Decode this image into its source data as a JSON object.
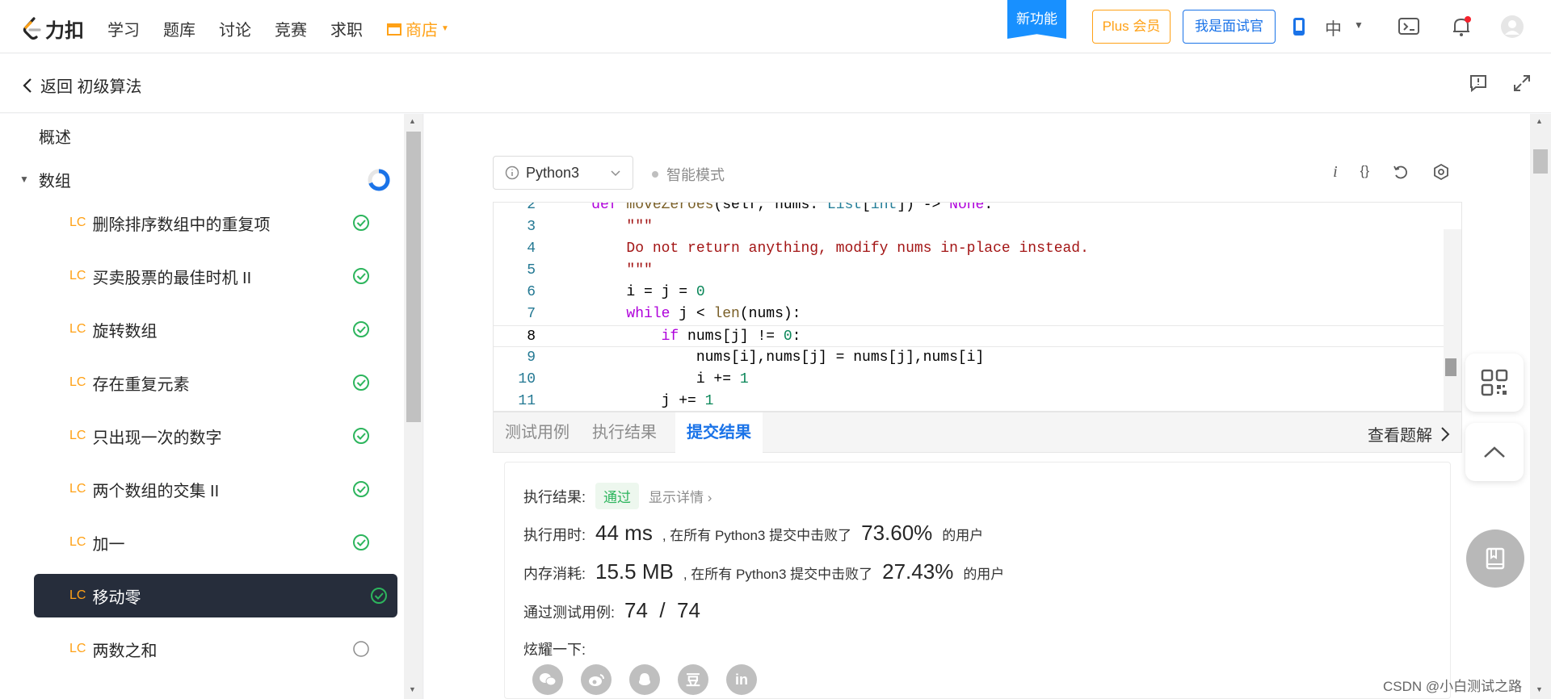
{
  "topnav": {
    "logo_text": "力扣",
    "links": [
      "学习",
      "题库",
      "讨论",
      "竞赛",
      "求职"
    ],
    "shop_label": "商店",
    "new_feature": "新功能",
    "plus_label": "Plus 会员",
    "interviewer_label": "我是面试官",
    "lang_label": "中"
  },
  "subheader": {
    "back_label": "返回 初级算法"
  },
  "sidebar": {
    "overview_label": "概述",
    "section_label": "数组",
    "items": [
      {
        "prefix": "LC",
        "label": "删除排序数组中的重复项",
        "status": "done"
      },
      {
        "prefix": "LC",
        "label": "买卖股票的最佳时机 II",
        "status": "done"
      },
      {
        "prefix": "LC",
        "label": "旋转数组",
        "status": "done"
      },
      {
        "prefix": "LC",
        "label": "存在重复元素",
        "status": "done"
      },
      {
        "prefix": "LC",
        "label": "只出现一次的数字",
        "status": "done"
      },
      {
        "prefix": "LC",
        "label": "两个数组的交集 II",
        "status": "done"
      },
      {
        "prefix": "LC",
        "label": "加一",
        "status": "done"
      },
      {
        "prefix": "LC",
        "label": "移动零",
        "status": "done",
        "active": true
      },
      {
        "prefix": "LC",
        "label": "两数之和",
        "status": "todo"
      }
    ]
  },
  "editor": {
    "language": "Python3",
    "smart_mode": "智能模式",
    "info_icon_label": "i",
    "braces_icon_label": "{}",
    "highlighted_line": "8",
    "lines": [
      {
        "no": "2",
        "segments": [
          [
            "kw",
            "    def "
          ],
          [
            "fn",
            "moveZeroes"
          ],
          [
            "",
            "(self, nums: "
          ],
          [
            "ty",
            "List"
          ],
          [
            "",
            "["
          ],
          [
            "ty",
            "int"
          ],
          [
            "",
            "]) -> "
          ],
          [
            "kw",
            "None"
          ],
          [
            "",
            ":"
          ]
        ]
      },
      {
        "no": "3",
        "segments": [
          [
            "str",
            "        \"\"\""
          ]
        ]
      },
      {
        "no": "4",
        "segments": [
          [
            "str",
            "        Do not return anything, modify nums in-place instead."
          ]
        ]
      },
      {
        "no": "5",
        "segments": [
          [
            "str",
            "        \"\"\""
          ]
        ]
      },
      {
        "no": "6",
        "segments": [
          [
            "",
            "        i = j = "
          ],
          [
            "num",
            "0"
          ]
        ]
      },
      {
        "no": "7",
        "segments": [
          [
            "kw",
            "        while "
          ],
          [
            "",
            "j < "
          ],
          [
            "fn",
            "len"
          ],
          [
            "",
            "(nums):"
          ]
        ]
      },
      {
        "no": "8",
        "segments": [
          [
            "kw",
            "            if "
          ],
          [
            "",
            "nums[j] != "
          ],
          [
            "num",
            "0"
          ],
          [
            "",
            ":"
          ]
        ]
      },
      {
        "no": "9",
        "segments": [
          [
            "",
            "                nums[i],nums[j] = nums[j],nums[i]"
          ]
        ]
      },
      {
        "no": "10",
        "segments": [
          [
            "",
            "                i += "
          ],
          [
            "num",
            "1"
          ]
        ]
      },
      {
        "no": "11",
        "segments": [
          [
            "",
            "            j += "
          ],
          [
            "num",
            "1"
          ]
        ]
      }
    ]
  },
  "tabs": {
    "items": [
      "测试用例",
      "执行结果",
      "提交结果"
    ],
    "active": "提交结果",
    "solution_label": "查看题解"
  },
  "result": {
    "status_label": "执行结果:",
    "status_value": "通过",
    "detail_label": "显示详情 ›",
    "time_label": "执行用时:",
    "time_value": "44 ms",
    "time_text_1": ", 在所有 Python3 提交中击败了",
    "time_percent": "73.60%",
    "time_text_2": "的用户",
    "mem_label": "内存消耗:",
    "mem_value": "15.5 MB",
    "mem_text_1": ", 在所有 Python3 提交中击败了",
    "mem_percent": "27.43%",
    "mem_text_2": "的用户",
    "cases_label": "通过测试用例:",
    "cases_value": "74  /  74",
    "share_label": "炫耀一下:",
    "share_icons": [
      "wechat-icon",
      "weibo-icon",
      "qq-icon",
      "douban-icon",
      "linkedin-icon"
    ],
    "share_glyphs": [
      "",
      "",
      "",
      "豆",
      "in"
    ]
  },
  "watermark": "CSDN @小白测试之路",
  "colors": {
    "accent": "#ffa116",
    "blue": "#1a73e8",
    "success": "#2db55d"
  }
}
